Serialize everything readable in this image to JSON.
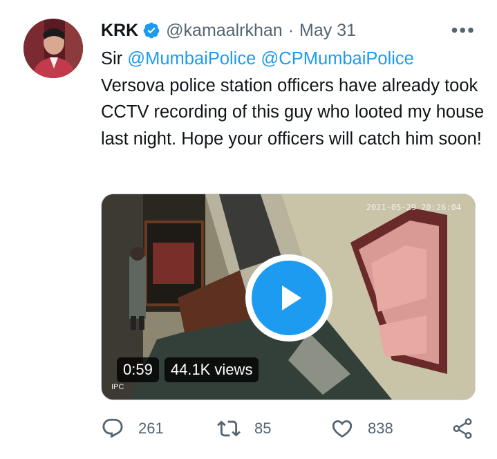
{
  "tweet": {
    "author_name": "KRK",
    "handle": "@kamaalrkhan",
    "separator": "·",
    "date": "May 31",
    "more_label": "•••",
    "text_prefix": "Sir ",
    "mention_1": "@MumbaiPolice",
    "mention_2": "@CPMumbaiPolice",
    "text_body": "Versova police station officers have already took CCTV recording of this guy who looted my house last night. Hope your officers will catch him soon!"
  },
  "media": {
    "timestamp": "2021-05-29 20:26:04",
    "camera_label": "IPC",
    "duration": "0:59",
    "views": "44.1K views"
  },
  "actions": {
    "replies": "261",
    "retweets": "85",
    "likes": "838"
  },
  "colors": {
    "accent": "#1d9bf0",
    "secondary_text": "#536471"
  }
}
